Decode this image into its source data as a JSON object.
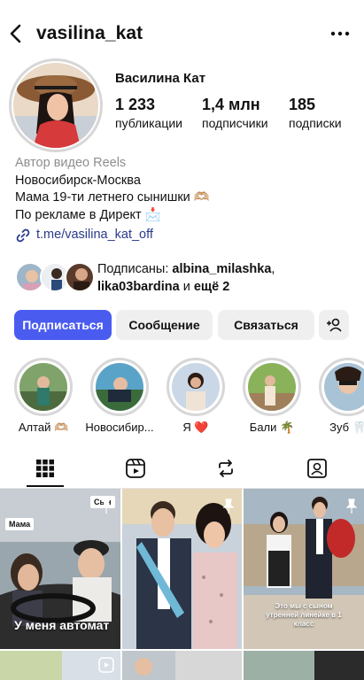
{
  "header": {
    "username": "vasilina_kat",
    "full_name": "Василина Кат"
  },
  "stats": {
    "posts_count": "1 233",
    "posts_label": "публикации",
    "followers_count": "1,4 млн",
    "followers_label": "подписчики",
    "following_count": "185",
    "following_label": "подписки"
  },
  "bio": {
    "category": "Автор видео Reels",
    "lines": [
      "Новосибирск-Москва",
      "Мама 19-ти летнего сынишки 🫶🏼",
      "По рекламе в Директ 📩"
    ],
    "link": "t.me/vasilina_kat_off"
  },
  "followed_by": {
    "prefix": "Подписаны: ",
    "first": "albina_milashka",
    "second": "lika03bardina",
    "suffix_and": " и ",
    "suffix_more": "ещё 2"
  },
  "actions": {
    "follow": "Подписаться",
    "message": "Сообщение",
    "contact": "Связаться"
  },
  "highlights": [
    {
      "label": "Алтай 🫶🏼"
    },
    {
      "label": "Новосибир..."
    },
    {
      "label": "Я ❤️"
    },
    {
      "label": "Бали 🌴"
    },
    {
      "label": "Зуб 🦷"
    }
  ],
  "grid": {
    "post1_sticker": "Мама",
    "post1_sticker2": "Сын",
    "post1_caption": "У меня автомат",
    "post3_caption": "Это мы с сыном утренней линейке в 1 класс"
  },
  "colors": {
    "accent": "#4a5cf0",
    "link": "#2b3a8c",
    "muted": "#8e8e8e"
  }
}
